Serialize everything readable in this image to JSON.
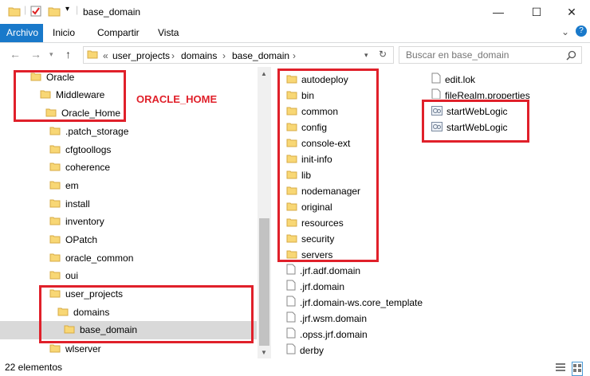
{
  "window": {
    "title": "base_domain",
    "controls": [
      "—",
      "☐",
      "✕"
    ]
  },
  "ribbon": {
    "tabs": [
      "Archivo",
      "Inicio",
      "Compartir",
      "Vista"
    ],
    "expand": "⌄",
    "help": "?"
  },
  "addressbar": {
    "prefix": "«",
    "segments": [
      "user_projects",
      "domains",
      "base_domain"
    ],
    "sep": "›",
    "search_placeholder": "Buscar en base_domain"
  },
  "navpane": {
    "items": [
      {
        "label": "Oracle"
      },
      {
        "label": "Middleware"
      },
      {
        "label": "Oracle_Home"
      },
      {
        "label": ".patch_storage"
      },
      {
        "label": "cfgtoollogs"
      },
      {
        "label": "coherence"
      },
      {
        "label": "em"
      },
      {
        "label": "install"
      },
      {
        "label": "inventory"
      },
      {
        "label": "OPatch"
      },
      {
        "label": "oracle_common"
      },
      {
        "label": "oui"
      },
      {
        "label": "user_projects"
      },
      {
        "label": "domains"
      },
      {
        "label": "base_domain"
      },
      {
        "label": "wlserver"
      }
    ]
  },
  "annotation": "ORACLE_HOME",
  "content": {
    "folders": [
      "autodeploy",
      "bin",
      "common",
      "config",
      "console-ext",
      "init-info",
      "lib",
      "nodemanager",
      "original",
      "resources",
      "security",
      "servers"
    ],
    "files_col1": [
      ".jrf.adf.domain",
      ".jrf.domain",
      ".jrf.domain-ws.core_template",
      ".jrf.wsm.domain",
      ".opss.jrf.domain",
      "derby"
    ],
    "files_col2": [
      "edit.lok",
      "fileRealm.properties",
      "startWebLogic",
      "startWebLogic"
    ]
  },
  "status": {
    "count": "22 elementos"
  },
  "colors": {
    "accent": "#1979ca",
    "folder": "#f8d775",
    "highlight": "#e0202a",
    "selection": "#d9d9d9"
  }
}
